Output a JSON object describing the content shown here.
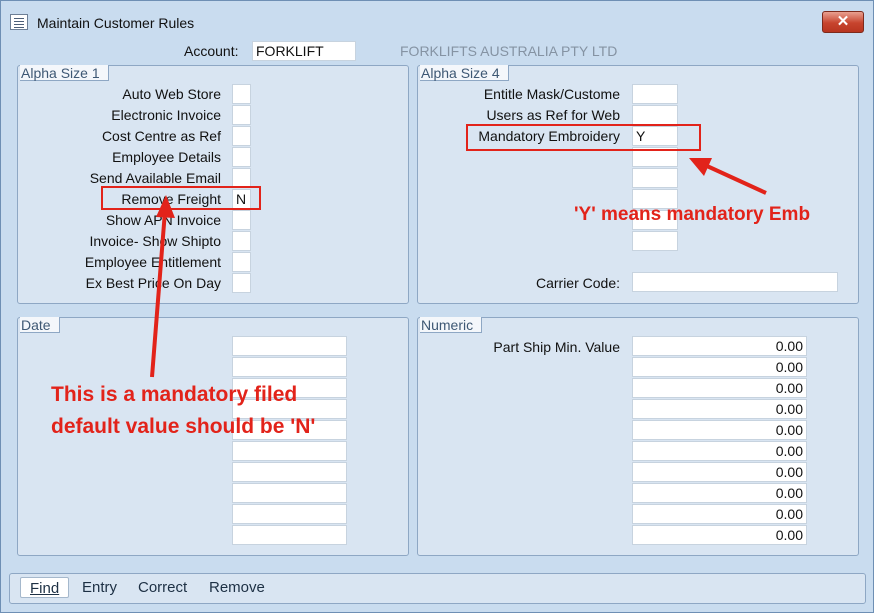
{
  "window": {
    "title": "Maintain Customer Rules",
    "close_glyph": "✕"
  },
  "account": {
    "label": "Account:",
    "value": "FORKLIFT",
    "company_name": "FORKLIFTS AUSTRALIA PTY LTD"
  },
  "alpha1": {
    "title": "Alpha Size 1",
    "rows": [
      {
        "label": "Auto Web Store",
        "value": ""
      },
      {
        "label": "Electronic Invoice",
        "value": ""
      },
      {
        "label": "Cost Centre as Ref",
        "value": ""
      },
      {
        "label": "Employee Details",
        "value": ""
      },
      {
        "label": "Send Available Email",
        "value": ""
      },
      {
        "label": "Remove Freight",
        "value": "N"
      },
      {
        "label": "Show APN Invoice",
        "value": ""
      },
      {
        "label": "Invoice- Show Shipto",
        "value": ""
      },
      {
        "label": "Employee Entitlement",
        "value": ""
      },
      {
        "label": "Ex Best Price On Day",
        "value": ""
      }
    ]
  },
  "alpha4": {
    "title": "Alpha Size 4",
    "rows": [
      {
        "label": "Entitle Mask/Custome",
        "value": ""
      },
      {
        "label": "Users as Ref for Web",
        "value": ""
      },
      {
        "label": "Mandatory Embroidery",
        "value": "Y"
      },
      {
        "label": "",
        "value": ""
      },
      {
        "label": "",
        "value": ""
      },
      {
        "label": "",
        "value": ""
      },
      {
        "label": "",
        "value": ""
      },
      {
        "label": "",
        "value": ""
      }
    ],
    "carrier_label": "Carrier Code:",
    "carrier_value": ""
  },
  "date": {
    "title": "Date",
    "values": [
      "",
      "",
      "",
      "",
      "",
      "",
      "",
      "",
      "",
      ""
    ]
  },
  "numeric": {
    "title": "Numeric",
    "first_label": "Part Ship Min. Value",
    "values": [
      "0.00",
      "0.00",
      "0.00",
      "0.00",
      "0.00",
      "0.00",
      "0.00",
      "0.00",
      "0.00",
      "0.00"
    ]
  },
  "bottom_menu": [
    "Find",
    "Entry",
    "Correct",
    "Remove"
  ],
  "annotations": {
    "emb_note": "'Y' means mandatory Emb",
    "freight_note_line1": "This is a mandatory filed",
    "freight_note_line2": "default value should be 'N'",
    "color": "#e2231a"
  }
}
